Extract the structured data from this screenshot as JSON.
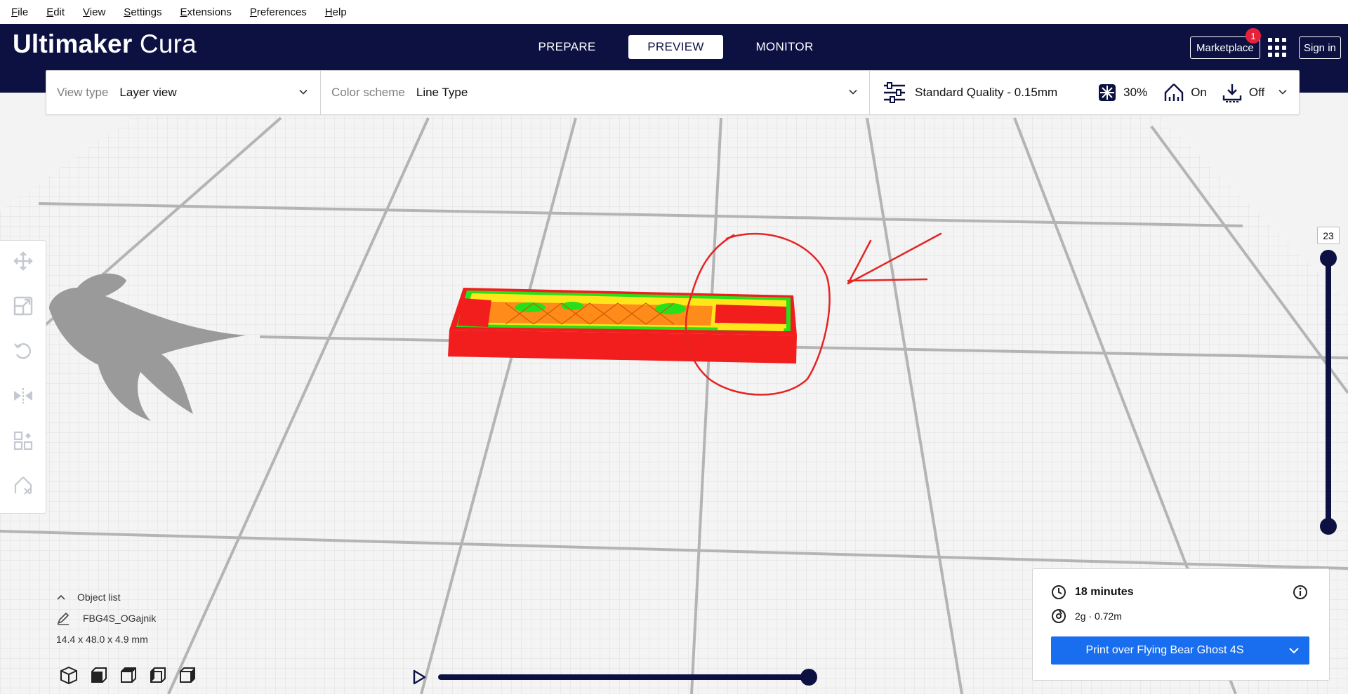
{
  "menu": [
    {
      "mnemonic": "F",
      "rest": "ile"
    },
    {
      "mnemonic": "E",
      "rest": "dit"
    },
    {
      "mnemonic": "V",
      "rest": "iew"
    },
    {
      "mnemonic": "S",
      "rest": "ettings"
    },
    {
      "mnemonic": "E",
      "rest": "xtensions"
    },
    {
      "mnemonic": "P",
      "rest": "references"
    },
    {
      "mnemonic": "H",
      "rest": "elp"
    }
  ],
  "header": {
    "logo_bold": "Ultimaker",
    "logo_light": "Cura",
    "stages": [
      "PREPARE",
      "PREVIEW",
      "MONITOR"
    ],
    "active_stage": "PREVIEW",
    "marketplace": "Marketplace",
    "marketplace_badge": "1",
    "sign_in": "Sign in"
  },
  "toolbar": {
    "view_type_label": "View type",
    "view_type_value": "Layer view",
    "color_scheme_label": "Color scheme",
    "color_scheme_value": "Line Type",
    "quality": "Standard Quality - 0.15mm",
    "infill": "30%",
    "support": "On",
    "adhesion": "Off"
  },
  "layer_slider": {
    "value": "23"
  },
  "object_list": {
    "title": "Object list",
    "item": "FBG4S_OGajnik",
    "dimensions": "14.4 x 48.0 x 4.9 mm"
  },
  "print": {
    "time": "18 minutes",
    "material": "2g · 0.72m",
    "button": "Print over Flying Bear Ghost 4S"
  },
  "colors": {
    "header_bg": "#0c1142",
    "accent_blue": "#196ef0",
    "wall_red": "#f21d1d",
    "infill_orange": "#ff8c1a",
    "skin_yellow": "#ffe61a",
    "inner_wall_green": "#26e01a",
    "annotation_red": "#e52424"
  }
}
